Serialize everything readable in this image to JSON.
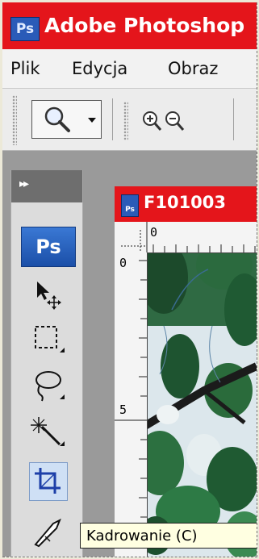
{
  "app": {
    "logo_text": "Ps",
    "title": "Adobe Photoshop"
  },
  "menu": {
    "items": [
      "Plik",
      "Edycja",
      "Obraz"
    ]
  },
  "toolbox": {
    "badge": "Ps",
    "tools": [
      {
        "name": "move",
        "icon": "move-icon"
      },
      {
        "name": "marquee",
        "icon": "rectangular-marquee-icon"
      },
      {
        "name": "lasso",
        "icon": "lasso-icon"
      },
      {
        "name": "magic-wand",
        "icon": "magic-wand-icon"
      },
      {
        "name": "crop",
        "icon": "crop-icon",
        "selected": true
      },
      {
        "name": "slice",
        "icon": "slice-icon"
      }
    ]
  },
  "document": {
    "icon_text": "Ps",
    "title": "F101003"
  },
  "rulers": {
    "h_label": "0",
    "v_labels": [
      "0",
      "5"
    ]
  },
  "tooltip": {
    "text": "Kadrowanie (C)"
  },
  "colors": {
    "title_bar": "#e4151b",
    "ps_blue": "#2a5bb8",
    "tooltip_bg": "#ffffe1"
  }
}
